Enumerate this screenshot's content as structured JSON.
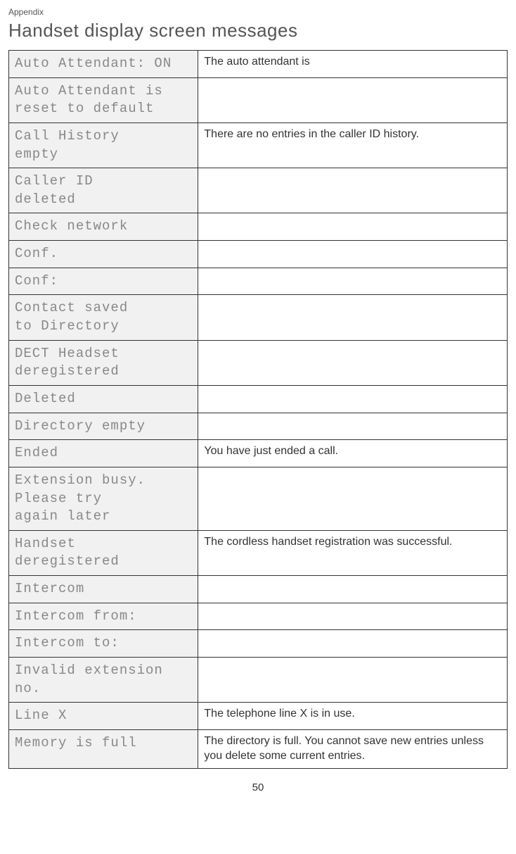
{
  "header": {
    "section": "Appendix",
    "title": "Handset display screen messages"
  },
  "rows": [
    {
      "lcd": "Auto Attendant: ON",
      "desc": "The auto attendant is"
    },
    {
      "lcd": "Auto Attendant is\nreset to default",
      "desc": ""
    },
    {
      "lcd": "Call History\nempty",
      "desc": "There are no entries in the caller ID history."
    },
    {
      "lcd": "Caller ID\ndeleted",
      "desc": ""
    },
    {
      "lcd": "Check network",
      "desc": ""
    },
    {
      "lcd": "Conf.",
      "desc": ""
    },
    {
      "lcd": "Conf:",
      "desc": ""
    },
    {
      "lcd": "Contact saved\nto Directory",
      "desc": ""
    },
    {
      "lcd": "DECT Headset\nderegistered",
      "desc": ""
    },
    {
      "lcd": "Deleted",
      "desc": ""
    },
    {
      "lcd": "Directory empty",
      "desc": ""
    },
    {
      "lcd": "Ended",
      "desc": "You have just ended a call."
    },
    {
      "lcd": "Extension busy.\nPlease try\nagain later",
      "desc": ""
    },
    {
      "lcd": "Handset\nderegistered",
      "desc": "The cordless handset registration was successful."
    },
    {
      "lcd": "Intercom",
      "desc": ""
    },
    {
      "lcd": "Intercom from:",
      "desc": ""
    },
    {
      "lcd": "Intercom to:",
      "desc": ""
    },
    {
      "lcd": "Invalid extension\nno.",
      "desc": ""
    },
    {
      "lcd": "Line X",
      "desc": "The telephone line X is in use."
    },
    {
      "lcd": "Memory is full",
      "desc": "The directory is full. You cannot save new entries unless you delete some current entries."
    }
  ],
  "page_number": "50"
}
